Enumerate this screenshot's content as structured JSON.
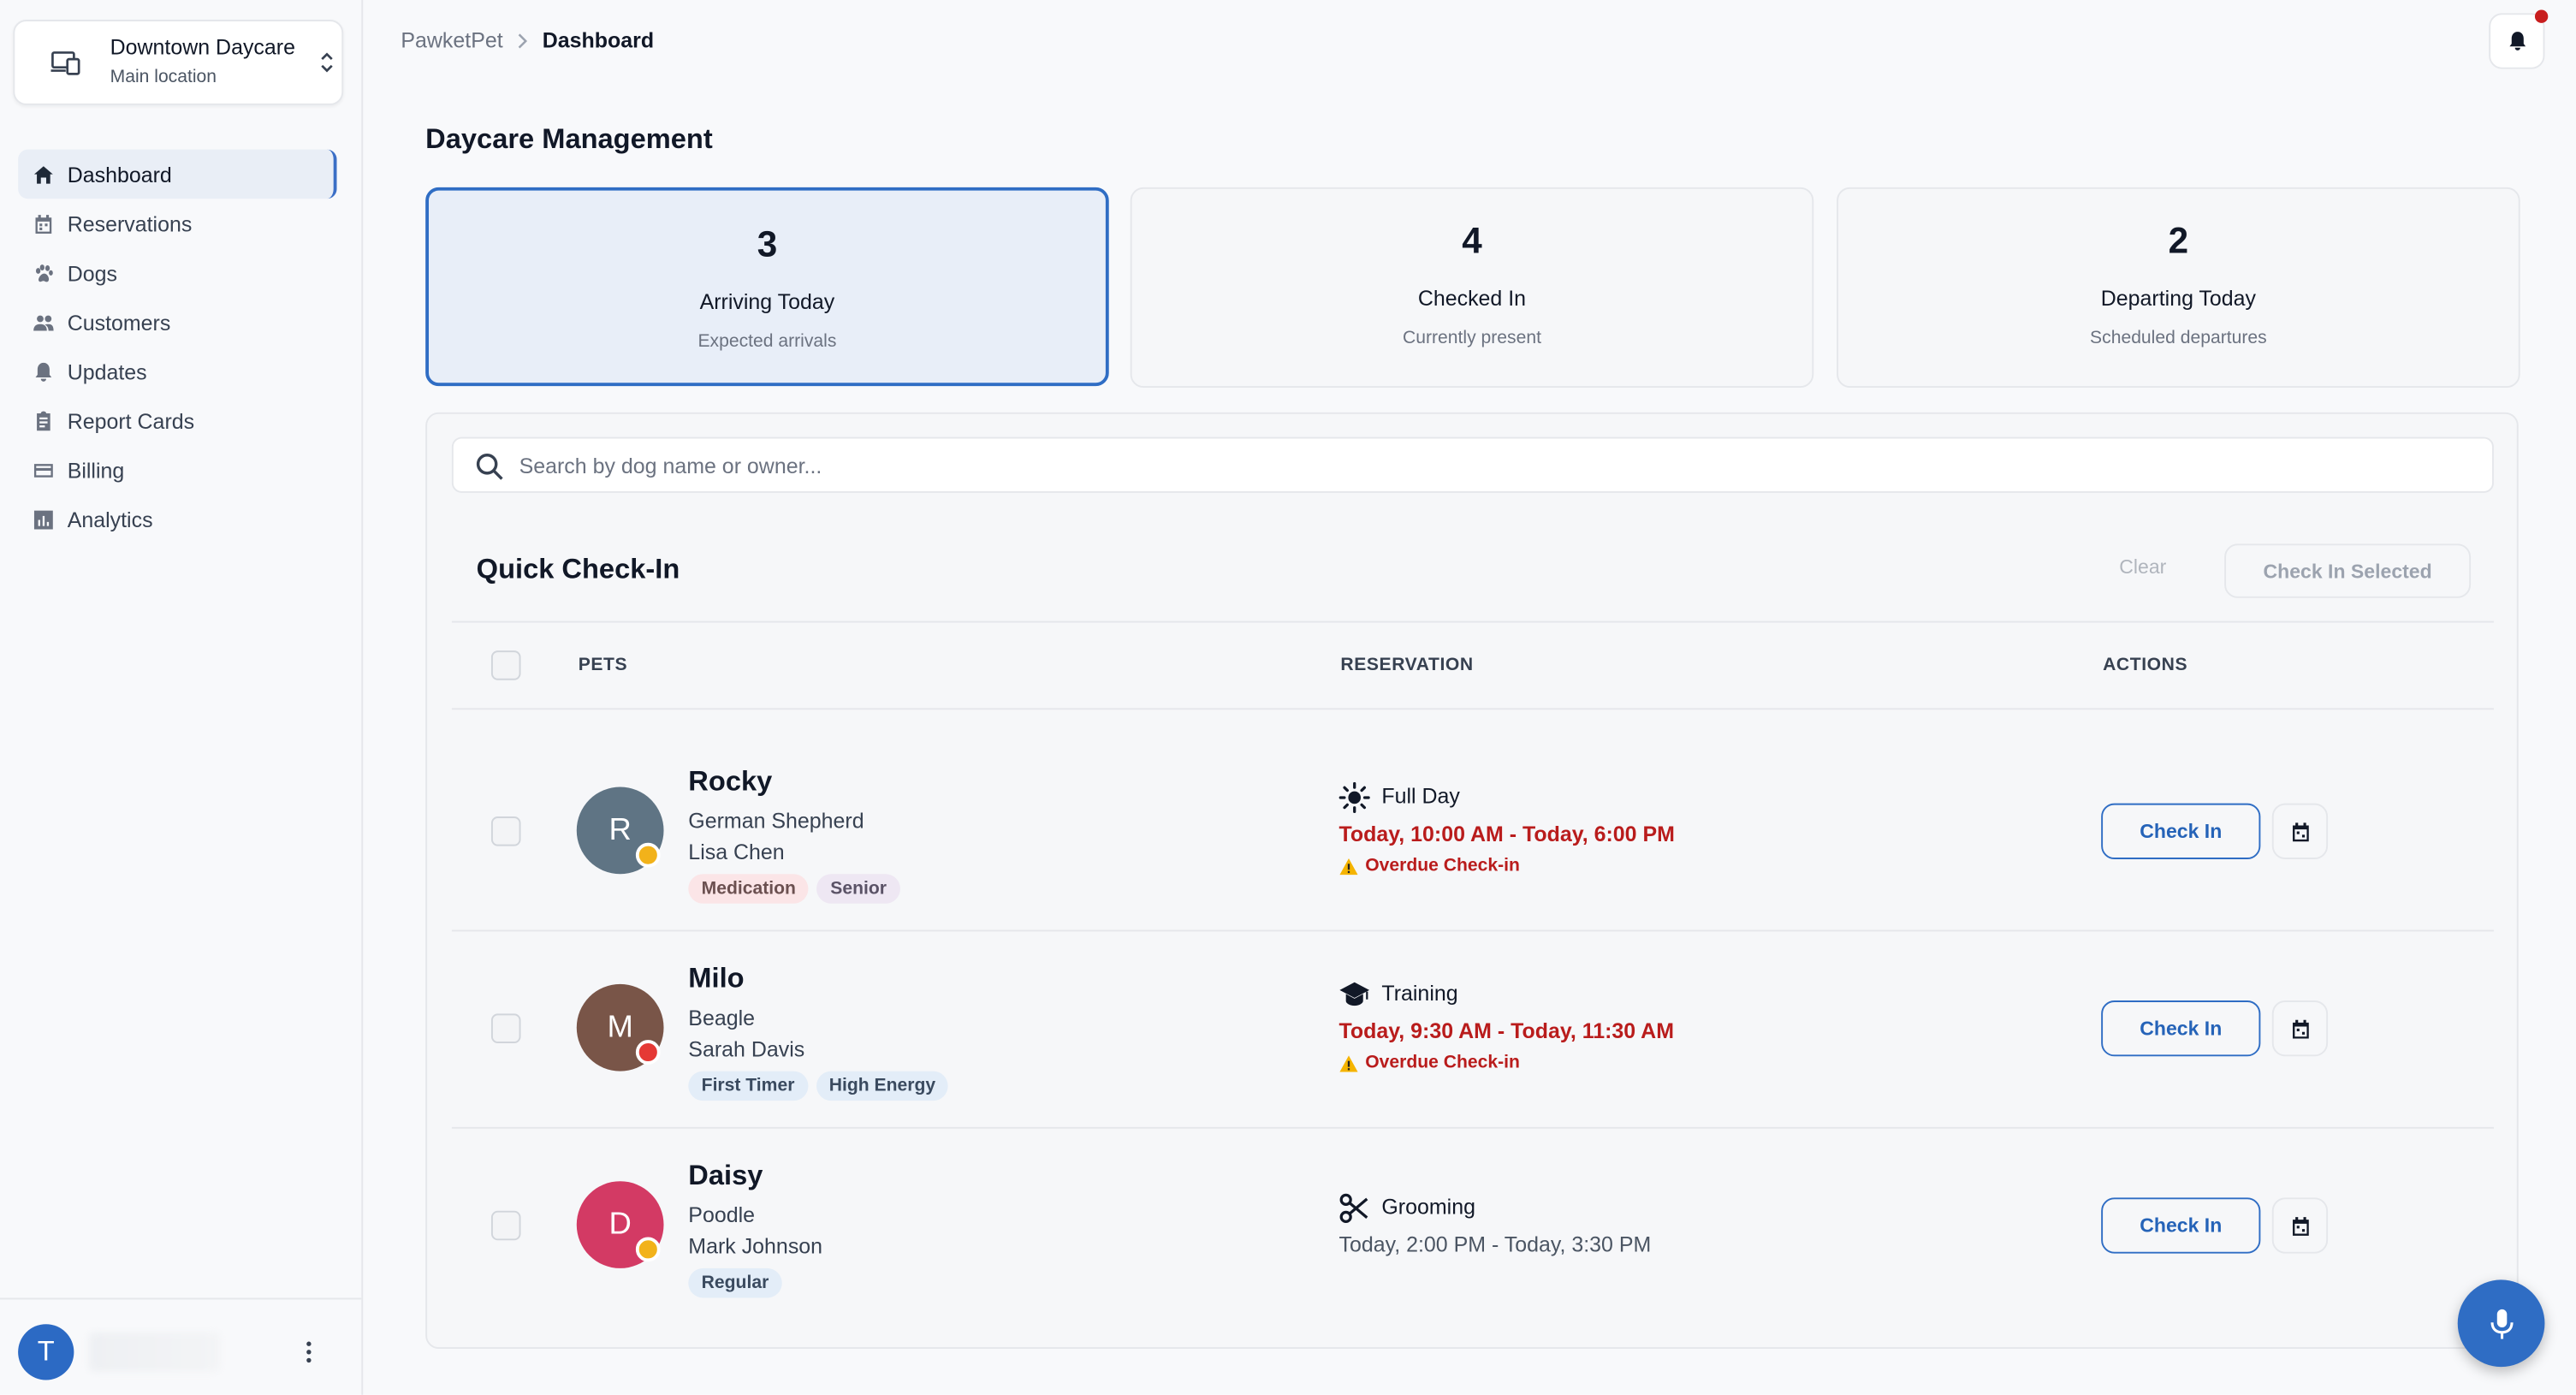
{
  "location": {
    "name": "Downtown Daycare",
    "subtitle": "Main location"
  },
  "nav": {
    "items": [
      {
        "label": "Dashboard",
        "icon": "home-icon",
        "active": true
      },
      {
        "label": "Reservations",
        "icon": "calendar-icon"
      },
      {
        "label": "Dogs",
        "icon": "paw-icon"
      },
      {
        "label": "Customers",
        "icon": "people-icon"
      },
      {
        "label": "Updates",
        "icon": "bell-icon"
      },
      {
        "label": "Report Cards",
        "icon": "clipboard-icon"
      },
      {
        "label": "Billing",
        "icon": "credit-card-icon"
      },
      {
        "label": "Analytics",
        "icon": "chart-icon"
      }
    ]
  },
  "user": {
    "initial": "T"
  },
  "breadcrumb": {
    "root": "PawketPet",
    "current": "Dashboard"
  },
  "page": {
    "title": "Daycare Management"
  },
  "stats": [
    {
      "value": "3",
      "label": "Arriving Today",
      "sub": "Expected arrivals"
    },
    {
      "value": "4",
      "label": "Checked In",
      "sub": "Currently present"
    },
    {
      "value": "2",
      "label": "Departing Today",
      "sub": "Scheduled departures"
    }
  ],
  "search": {
    "placeholder": "Search by dog name or owner..."
  },
  "quick_checkin": {
    "title": "Quick Check-In",
    "clear_label": "Clear",
    "check_selected_label": "Check In Selected",
    "columns": {
      "pets": "PETS",
      "reservation": "RESERVATION",
      "actions": "ACTIONS"
    }
  },
  "pets": [
    {
      "initial": "R",
      "name": "Rocky",
      "breed": "German Shepherd",
      "owner": "Lisa Chen",
      "avatar_color": "#5f7484",
      "status_color": "#f2b21a",
      "tags": [
        {
          "text": "Medication",
          "style": "pink"
        },
        {
          "text": "Senior",
          "style": "purple"
        }
      ],
      "service": "Full Day",
      "service_icon": "sun-icon",
      "time": "Today, 10:00 AM - Today, 6:00 PM",
      "overdue": true,
      "overdue_label": "Overdue Check-in",
      "action_label": "Check In"
    },
    {
      "initial": "M",
      "name": "Milo",
      "breed": "Beagle",
      "owner": "Sarah Davis",
      "avatar_color": "#795548",
      "status_color": "#e53935",
      "tags": [
        {
          "text": "First Timer",
          "style": "blue"
        },
        {
          "text": "High Energy",
          "style": "blue"
        }
      ],
      "service": "Training",
      "service_icon": "graduation-cap-icon",
      "time": "Today, 9:30 AM - Today, 11:30 AM",
      "overdue": true,
      "overdue_label": "Overdue Check-in",
      "action_label": "Check In"
    },
    {
      "initial": "D",
      "name": "Daisy",
      "breed": "Poodle",
      "owner": "Mark Johnson",
      "avatar_color": "#d33a64",
      "status_color": "#f2b21a",
      "tags": [
        {
          "text": "Regular",
          "style": "blue"
        }
      ],
      "service": "Grooming",
      "service_icon": "scissors-icon",
      "time": "Today, 2:00 PM - Today, 3:30 PM",
      "overdue": false,
      "overdue_label": "",
      "action_label": "Check In"
    }
  ]
}
